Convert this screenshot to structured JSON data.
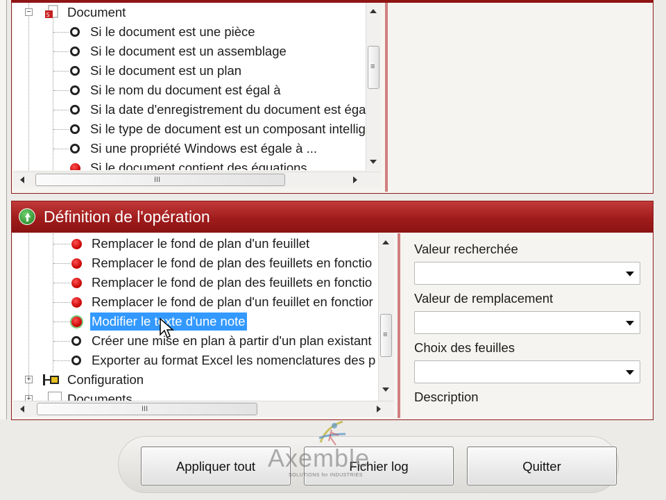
{
  "conditions_panel": {
    "tree": {
      "root_label": "Document",
      "items": [
        "Si le document est une pièce",
        "Si le document est un assemblage",
        "Si le document est un plan",
        "Si le nom du document est égal à",
        "Si la date d'enregistrement du document est éga",
        "Si le type de document est un composant intellig",
        "Si une propriété Windows est égale à ...",
        "Si le document contient des équations"
      ]
    }
  },
  "operation_panel": {
    "title": "Définition de l'opération",
    "tree": {
      "items": [
        {
          "label": "Remplacer le fond de plan d'un feuillet",
          "icon": "red-dot-icon"
        },
        {
          "label": "Remplacer le fond de plan des feuillets en fonctio",
          "icon": "red-dot-icon"
        },
        {
          "label": "Remplacer le fond de plan des feuillets en fonctio",
          "icon": "red-dot-icon"
        },
        {
          "label": "Remplacer le fond de plan d'un feuillet en fonctior",
          "icon": "red-dot-icon"
        },
        {
          "label": "Modifier le texte d'une note",
          "icon": "red-dot-icon",
          "selected": true
        },
        {
          "label": "Créer une mise en plan à partir d'un plan existant",
          "icon": "ring-icon"
        },
        {
          "label": "Exporter au format Excel les nomenclatures des p",
          "icon": "ring-icon"
        }
      ],
      "configuration_label": "Configuration",
      "partial_label": "Documents"
    },
    "fields": {
      "search_value_label": "Valeur recherchée",
      "search_value": "",
      "replace_value_label": "Valeur de remplacement",
      "replace_value": "",
      "sheets_label": "Choix des feuilles",
      "sheets_value": "",
      "description_label": "Description"
    }
  },
  "buttons": {
    "apply_all": "Appliquer tout",
    "log_file": "Fichier log",
    "quit": "Quitter"
  },
  "watermark": {
    "brand": "Axemble",
    "tagline": "SOLUTIONS for INDUSTRIES"
  },
  "colors": {
    "panel_header": "#a01c1c",
    "selection": "#3399ff",
    "active_item": "#c50000"
  }
}
